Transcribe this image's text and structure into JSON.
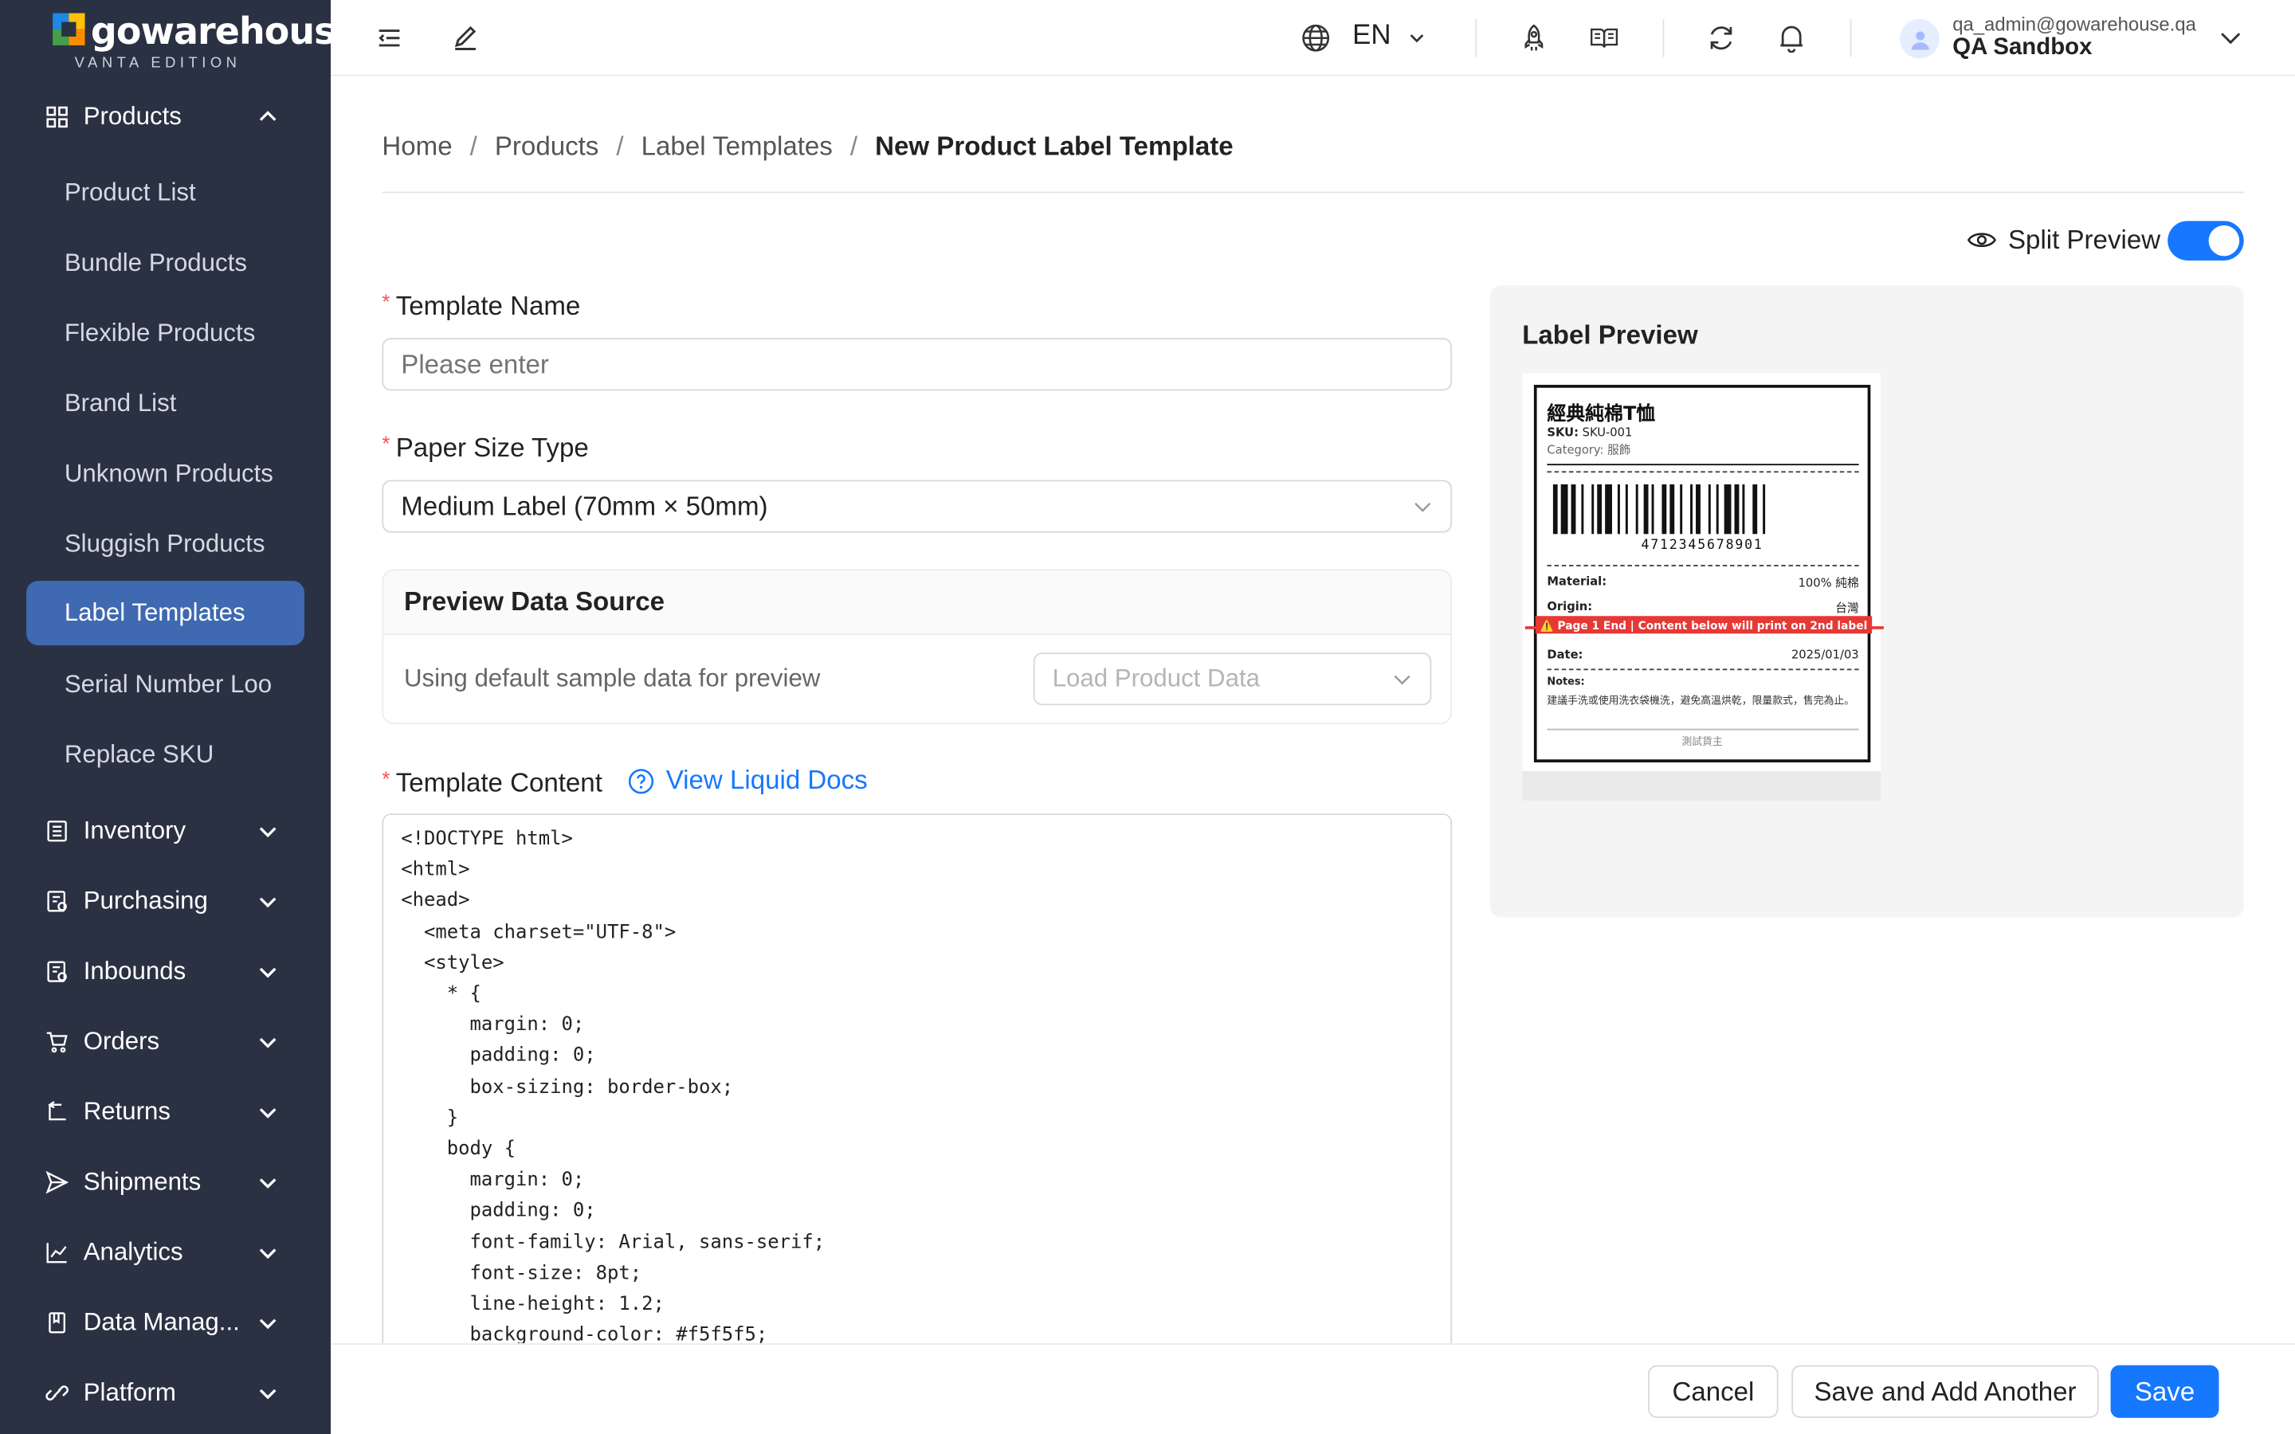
{
  "brand": {
    "name": "gowarehouse",
    "edition": "VANTA EDITION"
  },
  "sidebar": {
    "groups": [
      {
        "label": "Products",
        "icon": "grid-icon",
        "expanded": true
      },
      {
        "label": "Inventory",
        "icon": "inventory-icon"
      },
      {
        "label": "Purchasing",
        "icon": "purchasing-icon"
      },
      {
        "label": "Inbounds",
        "icon": "inbounds-icon"
      },
      {
        "label": "Orders",
        "icon": "cart-icon"
      },
      {
        "label": "Returns",
        "icon": "return-icon"
      },
      {
        "label": "Shipments",
        "icon": "send-icon"
      },
      {
        "label": "Analytics",
        "icon": "chart-icon"
      },
      {
        "label": "Data Manag...",
        "icon": "book-icon"
      },
      {
        "label": "Platform",
        "icon": "link-icon"
      }
    ],
    "product_items": [
      {
        "label": "Product List"
      },
      {
        "label": "Bundle Products"
      },
      {
        "label": "Flexible Products"
      },
      {
        "label": "Brand List"
      },
      {
        "label": "Unknown Products"
      },
      {
        "label": "Sluggish Products"
      },
      {
        "label": "Label Templates",
        "active": true
      },
      {
        "label": "Serial Number Loo"
      },
      {
        "label": "Replace SKU"
      }
    ]
  },
  "header": {
    "language": "EN",
    "user_email": "qa_admin@gowarehouse.qa",
    "user_org": "QA Sandbox"
  },
  "breadcrumb": [
    "Home",
    "Products",
    "Label Templates",
    "New Product Label Template"
  ],
  "split_preview": {
    "label": "Split Preview",
    "enabled": true
  },
  "form": {
    "template_name": {
      "label": "Template Name",
      "placeholder": "Please enter",
      "value": ""
    },
    "paper_size": {
      "label": "Paper Size Type",
      "value": "Medium Label (70mm × 50mm)"
    },
    "preview_source": {
      "title": "Preview Data Source",
      "text": "Using default sample data for preview",
      "select_placeholder": "Load Product Data"
    },
    "template_content": {
      "label": "Template Content",
      "docs_link": "View Liquid Docs",
      "code": "<!DOCTYPE html>\n<html>\n<head>\n  <meta charset=\"UTF-8\">\n  <style>\n    * {\n      margin: 0;\n      padding: 0;\n      box-sizing: border-box;\n    }\n    body {\n      margin: 0;\n      padding: 0;\n      font-family: Arial, sans-serif;\n      font-size: 8pt;\n      line-height: 1.2;\n      background-color: #f5f5f5;"
    }
  },
  "preview": {
    "title": "Label Preview",
    "label": {
      "product_name": "經典純棉T恤",
      "sku_key": "SKU:",
      "sku_value": "SKU-001",
      "category": "Category: 服飾",
      "barcode_number": "4712345678901",
      "material_key": "Material:",
      "material_value": "100% 純棉",
      "origin_key": "Origin:",
      "origin_value": "台灣",
      "page_warning": "⚠️ Page 1 End | Content below will print on 2nd label",
      "date_key": "Date:",
      "date_value": "2025/01/03",
      "notes_key": "Notes:",
      "notes_value": "建議手洗或使用洗衣袋機洗，避免高溫烘乾，限量款式，售完為止。",
      "footer": "測試貨主"
    }
  },
  "footer": {
    "cancel": "Cancel",
    "save_add": "Save and Add Another",
    "save": "Save"
  },
  "colors": {
    "sidebar_bg": "#2a3143",
    "active_item": "#3f69b0",
    "primary": "#1677ff",
    "warning": "#e53935"
  }
}
